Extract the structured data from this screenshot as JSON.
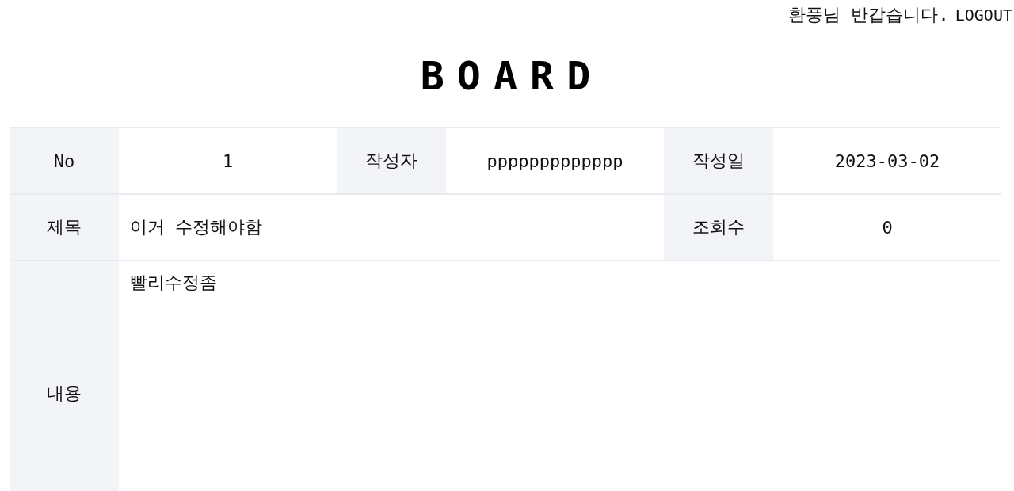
{
  "header": {
    "greeting": "환풍님 반갑습니다.",
    "logout": "LOGOUT"
  },
  "title": "BOARD",
  "rows": [
    {
      "fields": [
        {
          "kind": "short",
          "label": "No",
          "value": "1"
        },
        {
          "kind": "short",
          "label": "작성자",
          "value": "ppppppppppppp"
        },
        {
          "kind": "short",
          "label": "작성일",
          "value": "2023-03-02"
        }
      ]
    },
    {
      "fields": [
        {
          "kind": "wide",
          "label": "제목",
          "value": "이거 수정해야함"
        },
        {
          "kind": "short",
          "label": "조회수",
          "value": "0"
        }
      ]
    },
    {
      "fields": [
        {
          "kind": "body",
          "label": "내용",
          "value": "빨리수정좀"
        }
      ]
    }
  ]
}
